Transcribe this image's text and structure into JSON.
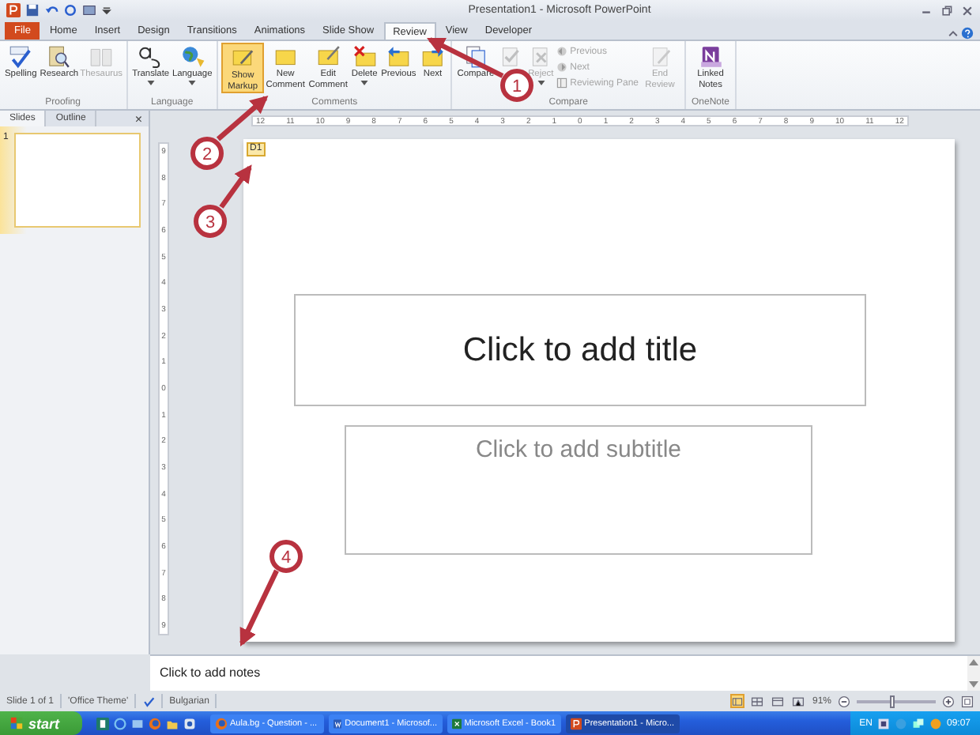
{
  "window": {
    "title": "Presentation1 - Microsoft PowerPoint"
  },
  "tabs": [
    {
      "label": "File",
      "kind": "file",
      "selected": false
    },
    {
      "label": "Home",
      "kind": "tab",
      "selected": false
    },
    {
      "label": "Insert",
      "kind": "tab",
      "selected": false
    },
    {
      "label": "Design",
      "kind": "tab",
      "selected": false
    },
    {
      "label": "Transitions",
      "kind": "tab",
      "selected": false
    },
    {
      "label": "Animations",
      "kind": "tab",
      "selected": false
    },
    {
      "label": "Slide Show",
      "kind": "tab",
      "selected": false
    },
    {
      "label": "Review",
      "kind": "tab",
      "selected": true
    },
    {
      "label": "View",
      "kind": "tab",
      "selected": false
    },
    {
      "label": "Developer",
      "kind": "tab",
      "selected": false
    }
  ],
  "ribbon_groups": [
    {
      "title": "Proofing",
      "items": [
        {
          "kind": "large",
          "label": "Spelling",
          "disabled": false
        },
        {
          "kind": "large",
          "label": "Research",
          "disabled": false
        },
        {
          "kind": "large",
          "label": "Thesaurus",
          "disabled": true
        }
      ]
    },
    {
      "title": "Language",
      "items": [
        {
          "kind": "large",
          "label": "Translate",
          "disabled": false,
          "dropdown": true
        },
        {
          "kind": "large",
          "label": "Language",
          "disabled": false,
          "dropdown": true
        }
      ]
    },
    {
      "title": "Comments",
      "items": [
        {
          "kind": "large",
          "label": "Show Markup",
          "disabled": false,
          "selected": true
        },
        {
          "kind": "large",
          "label": "New Comment",
          "disabled": false,
          "selected": false
        },
        {
          "kind": "large",
          "label": "Edit Comment",
          "disabled": false,
          "selected": false
        },
        {
          "kind": "large",
          "label": "Delete",
          "disabled": false,
          "dropdown": true,
          "selected": false
        },
        {
          "kind": "large",
          "label": "Previous",
          "disabled": false,
          "selected": false
        },
        {
          "kind": "large",
          "label": "Next",
          "disabled": false,
          "selected": false
        }
      ]
    },
    {
      "title": "Compare",
      "items": [
        {
          "kind": "large",
          "label": "Compare",
          "disabled": false
        },
        {
          "kind": "large",
          "disabled": true
        },
        {
          "kind": "large",
          "label": "Reject",
          "disabled": true,
          "dropdown": true
        },
        {
          "kind": "stack",
          "items": [
            {
              "label": "Previous",
              "disabled": true
            },
            {
              "label": "Next",
              "disabled": true
            },
            {
              "label": "Reviewing Pane",
              "disabled": true
            }
          ]
        },
        {
          "kind": "large",
          "label": "End Review",
          "disabled": true
        }
      ]
    },
    {
      "title": "OneNote",
      "items": [
        {
          "kind": "large",
          "label": "Linked Notes",
          "disabled": false
        }
      ]
    }
  ],
  "slide_pane": {
    "tabs": [
      {
        "label": "Slides",
        "selected": true
      },
      {
        "label": "Outline",
        "selected": false
      }
    ],
    "close": "×",
    "thumbnails": [
      {
        "number": "1",
        "selected": true
      }
    ]
  },
  "rulers": {
    "horizontal": [
      "12",
      "11",
      "10",
      "9",
      "8",
      "7",
      "6",
      "5",
      "4",
      "3",
      "2",
      "1",
      "0",
      "1",
      "2",
      "3",
      "4",
      "5",
      "6",
      "7",
      "8",
      "9",
      "10",
      "11",
      "12"
    ],
    "vertical": [
      "9",
      "8",
      "7",
      "6",
      "5",
      "4",
      "3",
      "2",
      "1",
      "0",
      "1",
      "2",
      "3",
      "4",
      "5",
      "6",
      "7",
      "8",
      "9"
    ]
  },
  "slide": {
    "comment_marker": "D1",
    "title_prompt": "Click to add title",
    "subtitle_prompt": "Click to add subtitle"
  },
  "notes": {
    "placeholder": "Click to add notes"
  },
  "status_bar": {
    "slide_info": "Slide 1 of 1",
    "theme": "'Office Theme'",
    "language": "Bulgarian",
    "views": [
      {
        "selected": true
      },
      {
        "selected": false
      },
      {
        "selected": false
      },
      {
        "selected": false
      }
    ],
    "zoom": "91%",
    "zoom_slider": {
      "level": 0.45
    }
  },
  "taskbar": {
    "start": "start",
    "tasks": [
      {
        "label": "Aula.bg - Question - ...",
        "selected": false
      },
      {
        "label": "Document1 - Microsof...",
        "selected": false
      },
      {
        "label": "Microsoft Excel - Book1",
        "selected": false
      },
      {
        "label": "Presentation1 - Micro...",
        "selected": true
      }
    ],
    "language": "EN",
    "clock": "09:07"
  },
  "annotations": [
    {
      "label": "1"
    },
    {
      "label": "2"
    },
    {
      "label": "3"
    },
    {
      "label": "4"
    }
  ]
}
